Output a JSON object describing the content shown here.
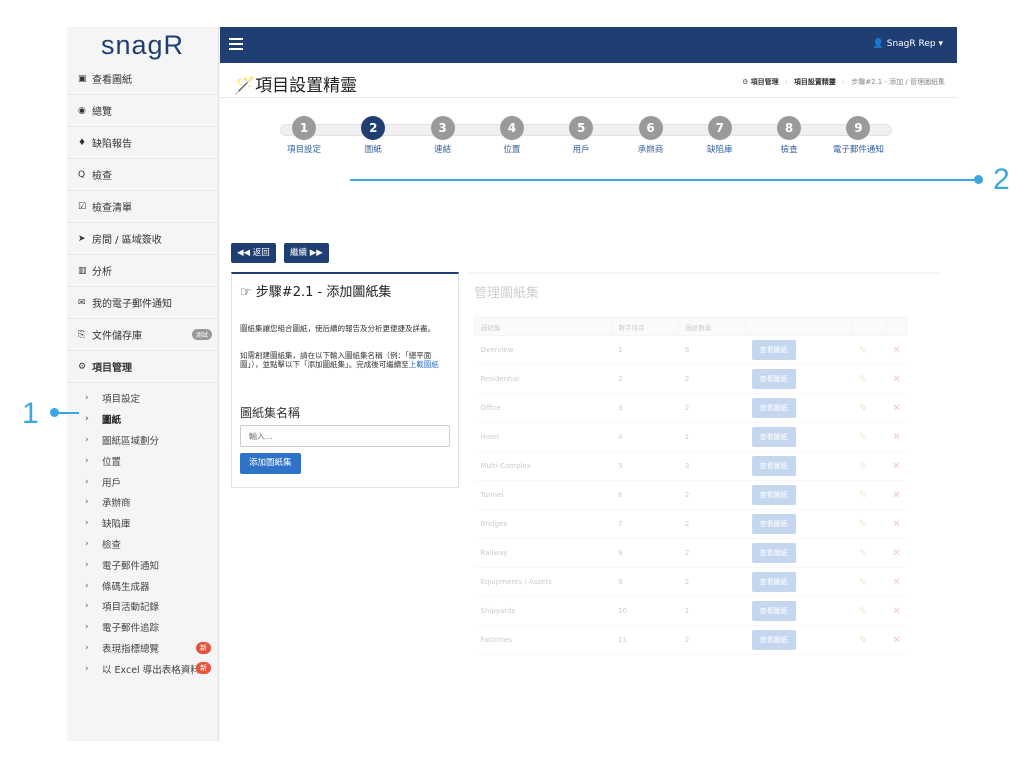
{
  "brand": {
    "logo_text": "snagR"
  },
  "topbar": {
    "user_label": "SnagR Rep ▾"
  },
  "sidebar": {
    "items": [
      {
        "icon": "image-icon",
        "glyph": "▣",
        "label": "查看圖紙"
      },
      {
        "icon": "dashboard-icon",
        "glyph": "◉",
        "label": "總覽"
      },
      {
        "icon": "map-pin-icon",
        "glyph": "♦",
        "label": "缺陷報告"
      },
      {
        "icon": "search-icon",
        "glyph": "Q",
        "label": "檢查"
      },
      {
        "icon": "checklist-icon",
        "glyph": "☑",
        "label": "檢查清單"
      },
      {
        "icon": "send-icon",
        "glyph": "➤",
        "label": "房間 / 區域簽收"
      },
      {
        "icon": "bar-chart-icon",
        "glyph": "▥",
        "label": "分析"
      },
      {
        "icon": "email-icon",
        "glyph": "✉",
        "label": "我的電子郵件通知"
      },
      {
        "icon": "document-icon",
        "glyph": "⎘",
        "label": "文件儲存庫",
        "badge": "測試"
      },
      {
        "icon": "gears-icon",
        "glyph": "⚙",
        "label": "項目管理"
      }
    ],
    "subitems": [
      {
        "label": "項目設定"
      },
      {
        "label": "圖紙"
      },
      {
        "label": "圖紙區域劃分"
      },
      {
        "label": "位置"
      },
      {
        "label": "用戶"
      },
      {
        "label": "承辦商"
      },
      {
        "label": "缺陷庫"
      },
      {
        "label": "檢查"
      },
      {
        "label": "電子郵件通知"
      },
      {
        "label": "條碼生成器"
      },
      {
        "label": "項目活動記錄"
      },
      {
        "label": "電子郵件追踪"
      },
      {
        "label": "表現指標總覽",
        "badge": "新"
      },
      {
        "label": "以 Excel 導出表格資料",
        "badge": "新"
      }
    ]
  },
  "header": {
    "title": "項目設置精靈",
    "breadcrumb": [
      "項目管理",
      "項目設置精靈",
      "步驟#2.1 - 添加 / 管理圖紙集"
    ]
  },
  "wizard": {
    "active_step": 2,
    "steps": [
      {
        "num": "1",
        "label": "項目設定"
      },
      {
        "num": "2",
        "label": "圖紙"
      },
      {
        "num": "3",
        "label": "連結"
      },
      {
        "num": "4",
        "label": "位置"
      },
      {
        "num": "5",
        "label": "用戶"
      },
      {
        "num": "6",
        "label": "承辦商"
      },
      {
        "num": "7",
        "label": "缺陷庫"
      },
      {
        "num": "8",
        "label": "檢查"
      },
      {
        "num": "9",
        "label": "電子郵件通知"
      }
    ]
  },
  "nav_buttons": {
    "back": "◀◀ 返回",
    "next": "繼續 ▶▶"
  },
  "step_panel": {
    "title": "步驟#2.1 - 添加圖紙集",
    "para1": "圖紙集讓您組合圖紙，使后續的報告及分析更便捷及詳盡。",
    "para2_prefix": "如需創建圖紙集，請在以下輸入圖紙集名稱（例：「總平面圖」），並點擊以下「添加圖紙集」。完成後可繼續至",
    "para2_link": "上載圖紙",
    "form_label": "圖紙集名稱",
    "input_placeholder": "輸入...",
    "add_button": "添加圖紙集"
  },
  "manage_panel": {
    "title": "管理圖紙集",
    "columns": [
      "圖紙集",
      "數字排序",
      "圖紙數量"
    ],
    "view_label": "查看圖紙",
    "rows": [
      {
        "name": "Overview",
        "order": "1",
        "count": "6"
      },
      {
        "name": "Residential",
        "order": "2",
        "count": "2"
      },
      {
        "name": "Office",
        "order": "3",
        "count": "2"
      },
      {
        "name": "Hotel",
        "order": "4",
        "count": "1"
      },
      {
        "name": "Multi-Complex",
        "order": "5",
        "count": "3"
      },
      {
        "name": "Tunnel",
        "order": "6",
        "count": "2"
      },
      {
        "name": "Bridges",
        "order": "7",
        "count": "2"
      },
      {
        "name": "Railway",
        "order": "8",
        "count": "2"
      },
      {
        "name": "Equipments / Assets",
        "order": "9",
        "count": "2"
      },
      {
        "name": "Shipyards",
        "order": "10",
        "count": "1"
      },
      {
        "name": "Factories",
        "order": "11",
        "count": "2"
      }
    ]
  },
  "callouts": [
    {
      "label": "1"
    },
    {
      "label": "2"
    }
  ],
  "colors": {
    "navy": "#1f3f73",
    "link_blue": "#2f73c9",
    "callout": "#3aa7e0",
    "badge_red": "#e5533d"
  }
}
